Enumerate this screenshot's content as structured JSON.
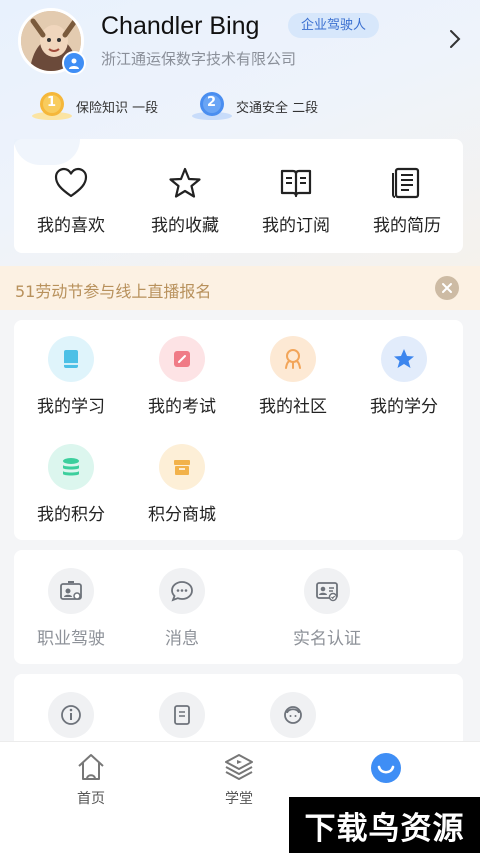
{
  "profile": {
    "name": "Chandler Bing",
    "role_badge": "企业驾驶人",
    "company": "浙江通运保数字技术有限公司"
  },
  "ranks": [
    {
      "medal_number": "1",
      "text": "保险知识 一段",
      "color": "#f5b73a"
    },
    {
      "medal_number": "2",
      "text": "交通安全 二段",
      "color": "#4a8ef0"
    }
  ],
  "quick_links": [
    {
      "label": "我的喜欢",
      "icon": "heart-icon"
    },
    {
      "label": "我的收藏",
      "icon": "star-icon"
    },
    {
      "label": "我的订阅",
      "icon": "book-icon"
    },
    {
      "label": "我的简历",
      "icon": "resume-icon"
    }
  ],
  "banner": {
    "text": "51劳动节参与线上直播报名"
  },
  "services": [
    {
      "label": "我的学习",
      "icon": "study-icon",
      "bg": "#dff4fb",
      "color": "#4cc0e6"
    },
    {
      "label": "我的考试",
      "icon": "exam-icon",
      "bg": "#fde3e5",
      "color": "#f07b86"
    },
    {
      "label": "我的社区",
      "icon": "community-icon",
      "bg": "#fde9d4",
      "color": "#f2a55a"
    },
    {
      "label": "我的学分",
      "icon": "credit-star-icon",
      "bg": "#e2ecfb",
      "color": "#3d86ee"
    },
    {
      "label": "我的积分",
      "icon": "points-icon",
      "bg": "#dcf6ee",
      "color": "#3ccf9d"
    },
    {
      "label": "积分商城",
      "icon": "mall-icon",
      "bg": "#fdefd7",
      "color": "#f2b24a"
    }
  ],
  "features": [
    {
      "label": "职业驾驶",
      "icon": "driver-card-icon"
    },
    {
      "label": "消息",
      "icon": "message-icon"
    },
    {
      "label": "实名认证",
      "icon": "id-verify-icon"
    }
  ],
  "more": [
    {
      "icon": "info-icon"
    },
    {
      "icon": "document-icon"
    },
    {
      "icon": "service-agent-icon"
    }
  ],
  "tabbar": {
    "tabs": [
      {
        "label": "首页",
        "icon": "home-icon"
      },
      {
        "label": "学堂",
        "icon": "school-icon"
      },
      {
        "label": "",
        "icon": "smile-icon"
      }
    ],
    "active_color": "#3f8ef5"
  },
  "watermark": "下载鸟资源"
}
